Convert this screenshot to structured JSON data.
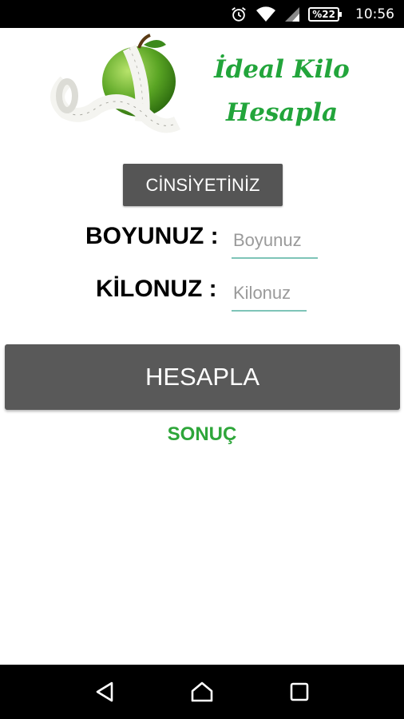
{
  "status_bar": {
    "battery": "%22",
    "time": "10:56",
    "icons": [
      "alarm-icon",
      "wifi-icon",
      "cell-signal-icon",
      "battery-icon"
    ]
  },
  "header": {
    "title_line1": "İdeal Kilo",
    "title_line2": "Hesapla",
    "logo_icon": "apple-measuring-tape-icon"
  },
  "form": {
    "gender_button_label": "CİNSİYETİNİZ",
    "height_label": "BOYUNUZ :",
    "height_placeholder": "Boyunuz",
    "height_value": "",
    "weight_label": "KİLONUZ :",
    "weight_placeholder": "Kilonuz",
    "weight_value": "",
    "calculate_label": "HESAPLA",
    "result_label": "SONUÇ"
  },
  "nav_bar": {
    "buttons": [
      "back-icon",
      "home-icon",
      "recents-icon"
    ]
  },
  "colors": {
    "accent_green": "#22a53b",
    "button_gray": "#555555",
    "input_underline": "#7ec4b8"
  }
}
